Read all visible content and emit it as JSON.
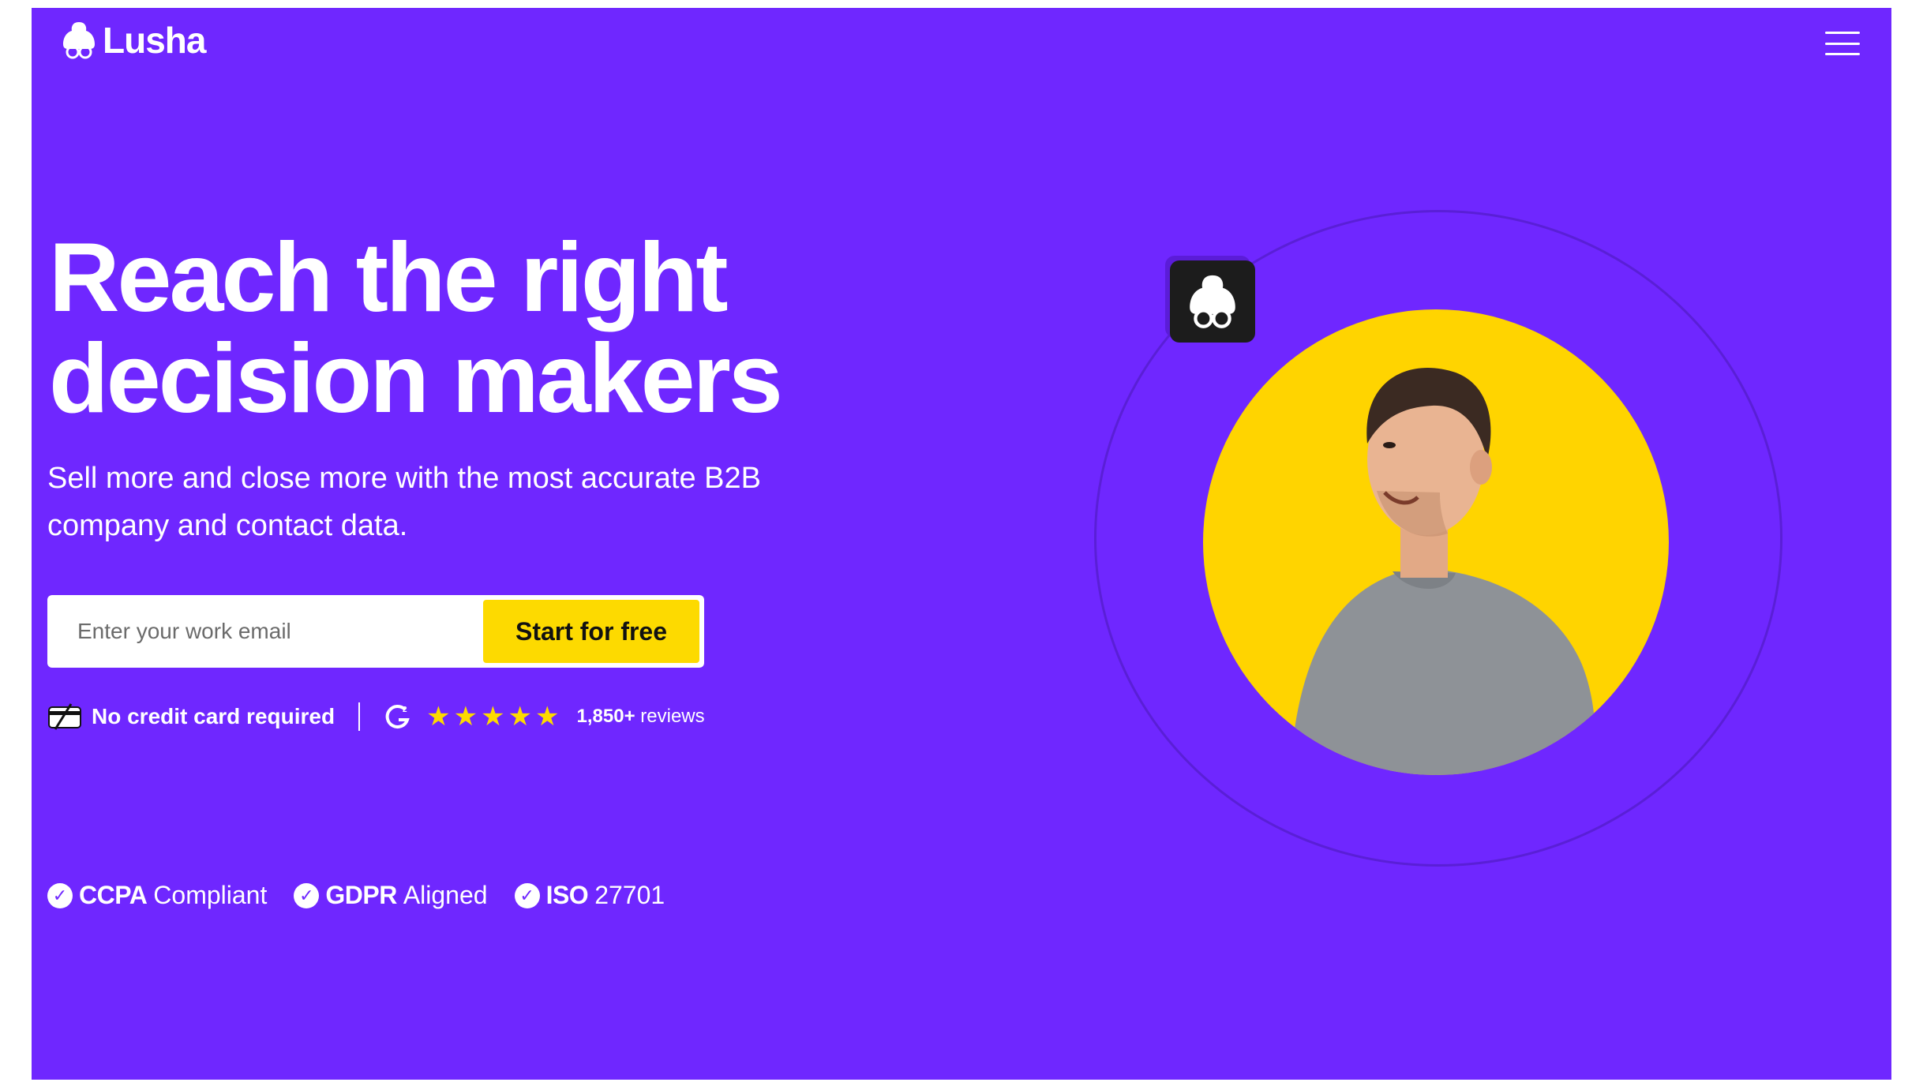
{
  "brand": {
    "name": "Lusha",
    "primary_color": "#6f27ff",
    "accent_color": "#fdda00"
  },
  "header": {
    "logo_icon": "lusha-logo-icon",
    "menu_icon": "hamburger-menu-icon"
  },
  "hero": {
    "headline_line1": "Reach the right",
    "headline_line2": "decision makers",
    "subtext": "Sell more and close more with the most accurate B2B company and contact data."
  },
  "signup": {
    "email_placeholder": "Enter your work email",
    "cta_label": "Start for free"
  },
  "trust": {
    "no_cc_icon": "credit-card-crossed-icon",
    "no_cc_label": "No credit card required",
    "g2_icon": "g2-logo-icon",
    "rating_stars": 5,
    "reviews_count": "1,850+",
    "reviews_label": "reviews"
  },
  "badges": [
    {
      "strong": "CCPA",
      "label": "Compliant"
    },
    {
      "strong": "GDPR",
      "label": "Aligned"
    },
    {
      "strong": "ISO",
      "label": "27701"
    }
  ],
  "illustration": {
    "app_icon": "lusha-app-icon",
    "photo": "smiling-man-photo",
    "circle_color": "#ffd400"
  }
}
